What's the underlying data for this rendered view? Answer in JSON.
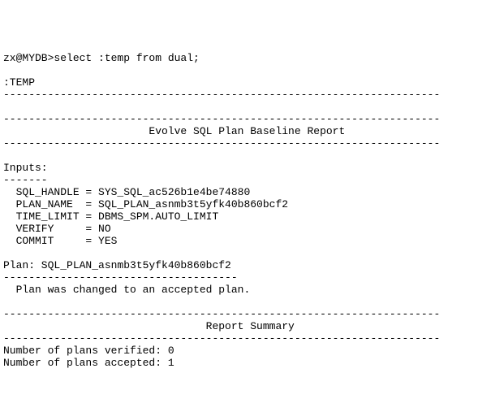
{
  "prompt": "zx@MYDB>select :temp from dual;",
  "col_header": ":TEMP",
  "dash_break": "---------------------------------------------------------------------",
  "dash_break_short": "-------------------------------------",
  "dash_break_inputs": "-------",
  "title": "                       Evolve SQL Plan Baseline Report                       ",
  "inputs_label": "Inputs:",
  "sql_handle_line": "  SQL_HANDLE = SYS_SQL_ac526b1e4be74880",
  "plan_name_line": "  PLAN_NAME  = SQL_PLAN_asnmb3t5yfk40b860bcf2",
  "time_limit_line": "  TIME_LIMIT = DBMS_SPM.AUTO_LIMIT",
  "verify_line": "  VERIFY     = NO",
  "commit_line": "  COMMIT     = YES",
  "plan_header": "Plan: SQL_PLAN_asnmb3t5yfk40b860bcf2",
  "plan_result": "  Plan was changed to an accepted plan.",
  "summary_title": "                                Report Summary",
  "verified_line": "Number of plans verified: 0",
  "accepted_line": "Number of plans accepted: 1"
}
